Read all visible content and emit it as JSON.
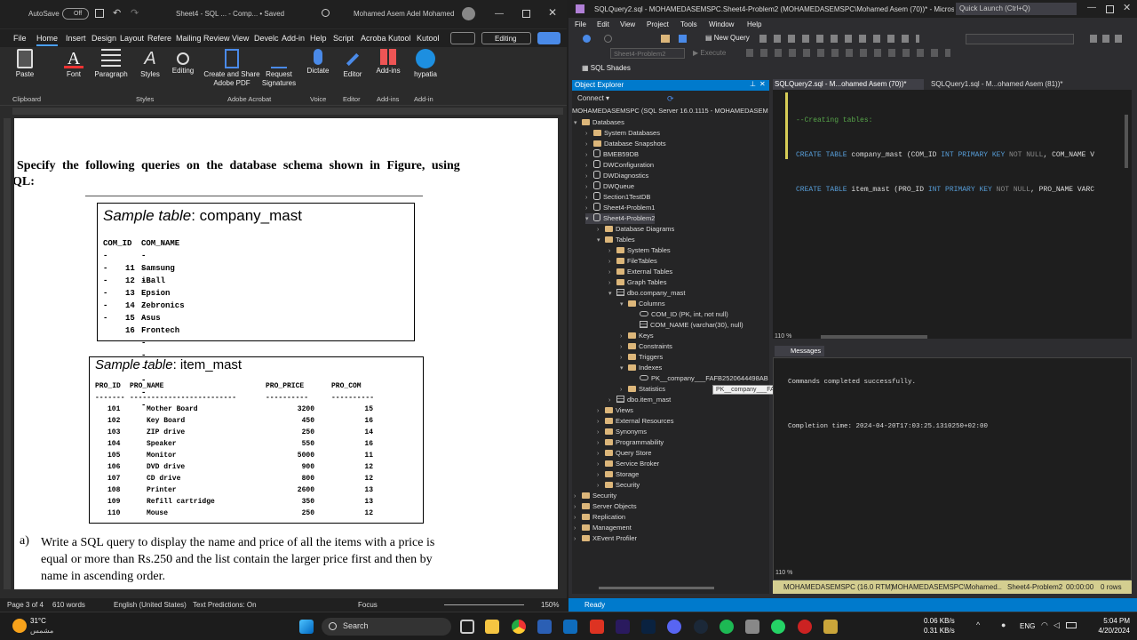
{
  "word": {
    "title_bar": {
      "autosave": "AutoSave",
      "autosave_state": "Off",
      "doc_title": "Sheet4 - SQL ... - Comp... • Saved",
      "user": "Mohamed Asem Adel Mohamed"
    },
    "menu": [
      "File",
      "Home",
      "Insert",
      "Design",
      "Layout",
      "Refere",
      "Mailing",
      "Review",
      "View",
      "Develc",
      "Add-in",
      "Help",
      "Script",
      "Acroba",
      "Kutool",
      "Kutool"
    ],
    "editing_btn": "Editing",
    "ribbon": {
      "buttons": [
        {
          "label": "Paste"
        },
        {
          "label": "Font"
        },
        {
          "label": "Paragraph"
        },
        {
          "label": "Styles"
        },
        {
          "label": "Editing"
        },
        {
          "label": "Create and Share\nAdobe PDF"
        },
        {
          "label": "Request\nSignatures"
        },
        {
          "label": "Dictate"
        },
        {
          "label": "Editor"
        },
        {
          "label": "Add-ins"
        },
        {
          "label": "hypatia"
        }
      ],
      "groups": [
        "Clipboard",
        "Styles",
        "Adobe Acrobat",
        "Voice",
        "Editor",
        "Add-ins",
        "Add-in"
      ]
    },
    "document": {
      "intro_line1": "Specify the following queries on the database schema shown in Figure, using",
      "intro_line2": "QL:",
      "company_caption_italic": "Sample table",
      "company_caption_rest": ": company_mast",
      "company_header": [
        "COM_ID",
        "COM_NAME"
      ],
      "company_dashes": [
        "------",
        "-------------"
      ],
      "company_rows": [
        [
          "11",
          "Samsung"
        ],
        [
          "12",
          "iBall"
        ],
        [
          "13",
          "Epsion"
        ],
        [
          "14",
          "Zebronics"
        ],
        [
          "15",
          "Asus"
        ],
        [
          "16",
          "Frontech"
        ]
      ],
      "item_caption_italic": "Sample table",
      "item_caption_rest": ": item_mast",
      "item_header": [
        "PRO_ID",
        "PRO_NAME",
        "PRO_PRICE",
        "PRO_COM"
      ],
      "item_dashes": [
        "-------",
        "-------------------------",
        "----------",
        "----------"
      ],
      "item_rows": [
        [
          "101",
          "Mother Board",
          "3200",
          "15"
        ],
        [
          "102",
          "Key Board",
          "450",
          "16"
        ],
        [
          "103",
          "ZIP drive",
          "250",
          "14"
        ],
        [
          "104",
          "Speaker",
          "550",
          "16"
        ],
        [
          "105",
          "Monitor",
          "5000",
          "11"
        ],
        [
          "106",
          "DVD drive",
          "900",
          "12"
        ],
        [
          "107",
          "CD drive",
          "800",
          "12"
        ],
        [
          "108",
          "Printer",
          "2600",
          "13"
        ],
        [
          "109",
          "Refill cartridge",
          "350",
          "13"
        ],
        [
          "110",
          "Mouse",
          "250",
          "12"
        ]
      ],
      "question_label": "a)",
      "question_lines": [
        "Write a SQL query to display the name and price of all the items with a price is",
        "equal or more than Rs.250 and the list contain the larger price first and then by",
        "name in ascending order."
      ]
    },
    "status": {
      "page": "Page 3 of 4",
      "words": "610 words",
      "lang": "English (United States)",
      "predictions": "Text Predictions: On",
      "focus": "Focus",
      "zoom": "150%"
    }
  },
  "ssms": {
    "title": "SQLQuery2.sql - MOHAMEDASEMSPC.Sheet4-Problem2 (MOHAMEDASEMSPC\\Mohamed Asem (70))* - Microsof...",
    "quick_launch": "Quick Launch (Ctrl+Q)",
    "menu": [
      "File",
      "Edit",
      "View",
      "Project",
      "Tools",
      "Window",
      "Help"
    ],
    "new_query": "New Query",
    "db_combo": "Sheet4-Problem2",
    "execute": "Execute",
    "sql_shades": "SQL Shades",
    "object_explorer": {
      "title": "Object Explorer",
      "connect": "Connect",
      "server": "MOHAMEDASEMSPC (SQL Server 16.0.1115 - MOHAMEDASEM",
      "nodes": [
        {
          "label": "Databases",
          "lvl": 0,
          "ex": "−",
          "icon": "folder"
        },
        {
          "label": "System Databases",
          "lvl": 1,
          "ex": "+",
          "icon": "folder"
        },
        {
          "label": "Database Snapshots",
          "lvl": 1,
          "ex": "+",
          "icon": "folder"
        },
        {
          "label": "BMEB59DB",
          "lvl": 1,
          "ex": "+",
          "icon": "db"
        },
        {
          "label": "DWConfiguration",
          "lvl": 1,
          "ex": "+",
          "icon": "db"
        },
        {
          "label": "DWDiagnostics",
          "lvl": 1,
          "ex": "+",
          "icon": "db"
        },
        {
          "label": "DWQueue",
          "lvl": 1,
          "ex": "+",
          "icon": "db"
        },
        {
          "label": "Section1TestDB",
          "lvl": 1,
          "ex": "+",
          "icon": "db"
        },
        {
          "label": "Sheet4-Problem1",
          "lvl": 1,
          "ex": "+",
          "icon": "db"
        },
        {
          "label": "Sheet4-Problem2",
          "lvl": 1,
          "ex": "−",
          "icon": "db",
          "sel": true
        },
        {
          "label": "Database Diagrams",
          "lvl": 2,
          "ex": "+",
          "icon": "folder"
        },
        {
          "label": "Tables",
          "lvl": 2,
          "ex": "−",
          "icon": "folder"
        },
        {
          "label": "System Tables",
          "lvl": 3,
          "ex": "+",
          "icon": "folder"
        },
        {
          "label": "FileTables",
          "lvl": 3,
          "ex": "+",
          "icon": "folder"
        },
        {
          "label": "External Tables",
          "lvl": 3,
          "ex": "+",
          "icon": "folder"
        },
        {
          "label": "Graph Tables",
          "lvl": 3,
          "ex": "+",
          "icon": "folder"
        },
        {
          "label": "dbo.company_mast",
          "lvl": 3,
          "ex": "−",
          "icon": "table"
        },
        {
          "label": "Columns",
          "lvl": 4,
          "ex": "−",
          "icon": "folder"
        },
        {
          "label": "COM_ID (PK, int, not null)",
          "lvl": 5,
          "ex": "",
          "icon": "key"
        },
        {
          "label": "COM_NAME (varchar(30), null)",
          "lvl": 5,
          "ex": "",
          "icon": "col"
        },
        {
          "label": "Keys",
          "lvl": 4,
          "ex": "+",
          "icon": "folder"
        },
        {
          "label": "Constraints",
          "lvl": 4,
          "ex": "+",
          "icon": "folder"
        },
        {
          "label": "Triggers",
          "lvl": 4,
          "ex": "+",
          "icon": "folder"
        },
        {
          "label": "Indexes",
          "lvl": 4,
          "ex": "−",
          "icon": "folder"
        },
        {
          "label": "PK__company___FAFB2520644498AB (Clus",
          "lvl": 5,
          "ex": "",
          "icon": "key"
        },
        {
          "label": "Statistics",
          "lvl": 4,
          "ex": "+",
          "icon": "folder"
        },
        {
          "label": "dbo.item_mast",
          "lvl": 3,
          "ex": "+",
          "icon": "table"
        },
        {
          "label": "Views",
          "lvl": 2,
          "ex": "+",
          "icon": "folder"
        },
        {
          "label": "External Resources",
          "lvl": 2,
          "ex": "+",
          "icon": "folder"
        },
        {
          "label": "Synonyms",
          "lvl": 2,
          "ex": "+",
          "icon": "folder"
        },
        {
          "label": "Programmability",
          "lvl": 2,
          "ex": "+",
          "icon": "folder"
        },
        {
          "label": "Query Store",
          "lvl": 2,
          "ex": "+",
          "icon": "folder"
        },
        {
          "label": "Service Broker",
          "lvl": 2,
          "ex": "+",
          "icon": "folder"
        },
        {
          "label": "Storage",
          "lvl": 2,
          "ex": "+",
          "icon": "folder"
        },
        {
          "label": "Security",
          "lvl": 2,
          "ex": "+",
          "icon": "folder"
        },
        {
          "label": "Security",
          "lvl": 0,
          "ex": "+",
          "icon": "folder"
        },
        {
          "label": "Server Objects",
          "lvl": 0,
          "ex": "+",
          "icon": "folder"
        },
        {
          "label": "Replication",
          "lvl": 0,
          "ex": "+",
          "icon": "folder"
        },
        {
          "label": "Management",
          "lvl": 0,
          "ex": "+",
          "icon": "folder"
        },
        {
          "label": "XEvent Profiler",
          "lvl": 0,
          "ex": "+",
          "icon": "folder"
        }
      ],
      "tooltip": "PK__company___FAFB2520644498AB (Clustered)"
    },
    "tabs": [
      "SQLQuery2.sql - M...ohamed Asem (70))*",
      "SQLQuery1.sql - M...ohamed Asem (81))*"
    ],
    "editor_lines": [
      {
        "comment": "--Creating tables:"
      },
      {
        "kw1": "CREATE TABLE",
        "name": " company_mast ",
        "rest": "(COM_ID ",
        "kw2": "INT PRIMARY KEY",
        "gray": " NOT NULL",
        "tail": ", COM_NAME V"
      },
      {
        "kw1": "CREATE TABLE",
        "name": " item_mast ",
        "rest": "(PRO_ID ",
        "kw2": "INT PRIMARY KEY",
        "gray": " NOT NULL",
        "tail": ", PRO_NAME VARC"
      }
    ],
    "editor_zoom": "110 %",
    "messages_tab": "Messages",
    "messages": [
      "Commands completed successfully.",
      "",
      "Completion time: 2024-04-20T17:03:25.1310250+02:00"
    ],
    "msg_zoom": "110 %",
    "query_status": {
      "server": "MOHAMEDASEMSPC (16.0 RTM)",
      "user": "MOHAMEDASEMSPC\\Mohamed...",
      "db": "Sheet4-Problem2",
      "time": "00:00:00",
      "rows": "0 rows"
    },
    "status": "Ready"
  },
  "taskbar": {
    "weather_temp": "31°C",
    "weather_desc": "مشمس",
    "search": "Search",
    "net_up": "0.06 KB/s",
    "net_down": "0.31 KB/s",
    "lang": "ENG",
    "time": "5:04 PM",
    "date": "4/20/2024"
  },
  "colors": {
    "ssms_accent": "#007acc",
    "word_bg": "#2b2b2b",
    "keyword": "#569cd6",
    "comment": "#57a64a"
  }
}
